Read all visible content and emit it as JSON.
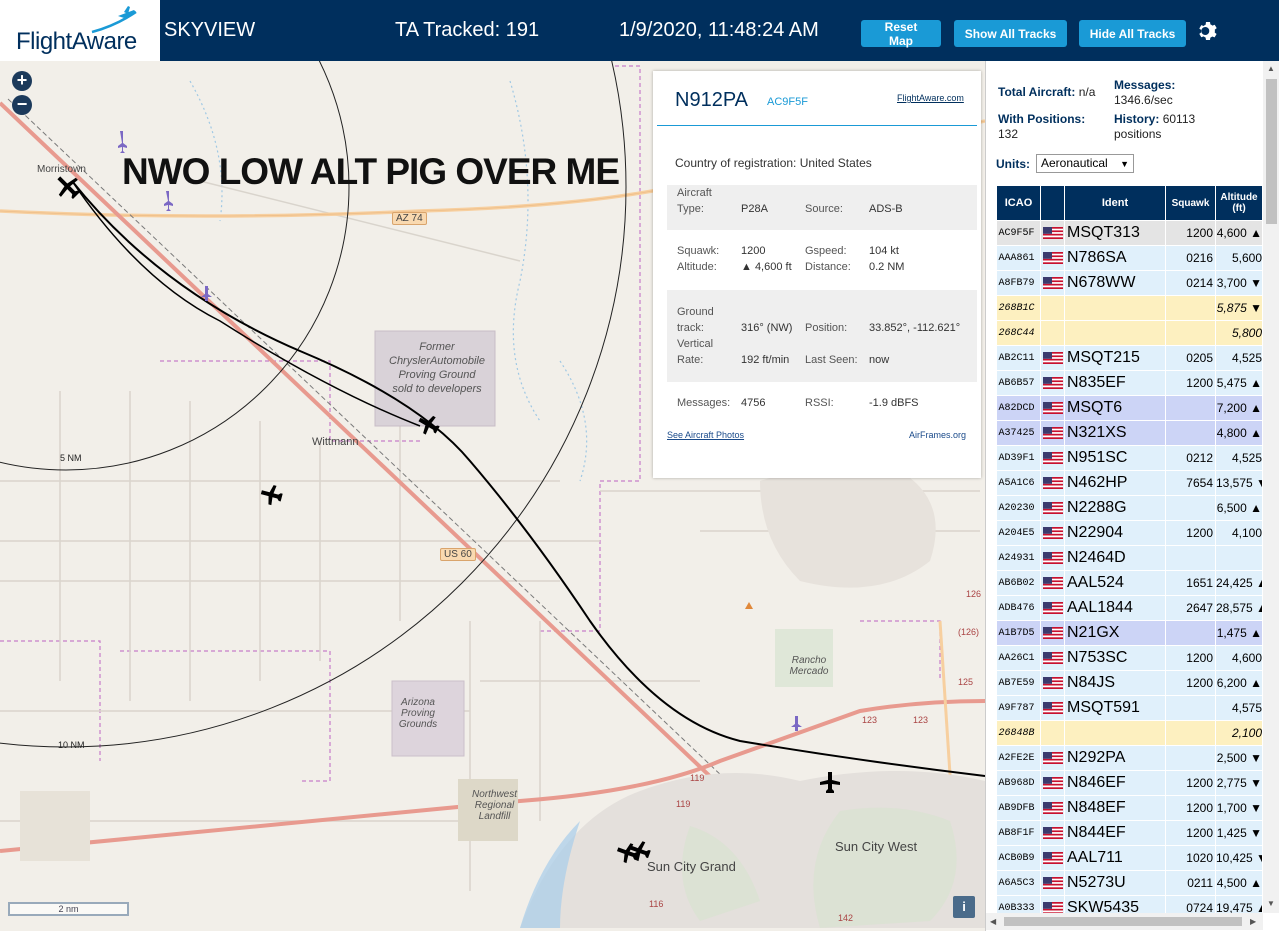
{
  "header": {
    "logo": "FlightAware",
    "title": "SKYVIEW",
    "tracked": "TA Tracked: 191",
    "datetime": "1/9/2020, 11:48:24 AM",
    "buttons": {
      "reset": "Reset Map",
      "show_all": "Show All Tracks",
      "hide_all": "Hide All Tracks"
    }
  },
  "map": {
    "overlay_text": "NWO LOW ALT PIG OVER ME",
    "zoom_in": "+",
    "zoom_out": "−",
    "labels": {
      "morristown": "Morristown",
      "wittmann": "Wittmann",
      "chrysler": "Former ChryslerAutomobile Proving Ground sold to developers",
      "arizona_pg": "Arizona Proving Grounds",
      "rancho": "Rancho Mercado",
      "landfill": "Northwest Regional Landfill",
      "sun_city_grand": "Sun City Grand",
      "sun_city_west": "Sun City West"
    },
    "shields": {
      "az74": "AZ 74",
      "us60": "US 60",
      "r123a": "123",
      "r123b": "123",
      "r119a": "119",
      "r119b": "119",
      "r116": "116",
      "r142": "142",
      "r126a": "126",
      "r126b": "(126)",
      "r125": "125"
    },
    "rings": {
      "r5": "5 NM",
      "r10": "10 NM"
    },
    "scale": "2 nm",
    "info": "i"
  },
  "popup": {
    "registration": "N912PA",
    "hex": "AC9F5F",
    "fa_link": "FlightAware.com",
    "country_label": "Country of registration:",
    "country": "United States",
    "aircraft_type_label": "Aircraft Type:",
    "aircraft_type_l1": "Aircraft",
    "aircraft_type_l2": "Type:",
    "aircraft_type": "P28A",
    "source_label": "Source:",
    "source": "ADS-B",
    "squawk_label": "Squawk:",
    "squawk": "1200",
    "gspeed_label": "Gspeed:",
    "gspeed": "104 kt",
    "altitude_label": "Altitude:",
    "altitude": "▲ 4,600 ft",
    "distance_label": "Distance:",
    "distance": "0.2 NM",
    "ground_track_l1": "Ground",
    "ground_track_l2": "track:",
    "ground_track": "316° (NW)",
    "position_label": "Position:",
    "position": "33.852°, -112.621°",
    "vertical_l1": "Vertical",
    "vertical_l2": "Rate:",
    "vertical_rate": "192 ft/min",
    "last_seen_label": "Last Seen:",
    "last_seen": "now",
    "messages_label": "Messages:",
    "messages": "4756",
    "rssi_label": "RSSI:",
    "rssi": "-1.9 dBFS",
    "photos_link": "See Aircraft Photos",
    "airframes_link": "AirFrames.org"
  },
  "stats": {
    "total_label": "Total Aircraft:",
    "total": "n/a",
    "messages_label": "Messages:",
    "messages": "1346.6/sec",
    "positions_label": "With Positions:",
    "positions": "132",
    "history_label": "History:",
    "history": "60113",
    "history_unit": "positions"
  },
  "units": {
    "label": "Units:",
    "selected": "Aeronautical"
  },
  "table": {
    "headers": {
      "icao": "ICAO",
      "ident": "Ident",
      "squawk": "Squawk",
      "altitude": "Altitude (ft)"
    },
    "rows": [
      {
        "icao": "AC9F5F",
        "flag": true,
        "ident": "MSQT313",
        "squawk": "1200",
        "altitude": "4,600 ▲",
        "style": "selected"
      },
      {
        "icao": "AAA861",
        "flag": true,
        "ident": "N786SA",
        "squawk": "0216",
        "altitude": "5,600",
        "style": "blue"
      },
      {
        "icao": "A8FB79",
        "flag": true,
        "ident": "N678WW",
        "squawk": "0214",
        "altitude": "3,700 ▼",
        "style": "blue"
      },
      {
        "icao": "268B1C",
        "flag": false,
        "ident": "",
        "squawk": "",
        "altitude": "5,875 ▼",
        "style": "yellow"
      },
      {
        "icao": "268C44",
        "flag": false,
        "ident": "",
        "squawk": "",
        "altitude": "5,800",
        "style": "yellow"
      },
      {
        "icao": "AB2C11",
        "flag": true,
        "ident": "MSQT215",
        "squawk": "0205",
        "altitude": "4,525",
        "style": "blue"
      },
      {
        "icao": "AB6B57",
        "flag": true,
        "ident": "N835EF",
        "squawk": "1200",
        "altitude": "5,475 ▲",
        "style": "blue"
      },
      {
        "icao": "A82DCD",
        "flag": true,
        "ident": "MSQT6",
        "squawk": "",
        "altitude": "7,200 ▲",
        "style": "purple"
      },
      {
        "icao": "A37425",
        "flag": true,
        "ident": "N321XS",
        "squawk": "",
        "altitude": "4,800 ▲",
        "style": "purple"
      },
      {
        "icao": "AD39F1",
        "flag": true,
        "ident": "N951SC",
        "squawk": "0212",
        "altitude": "4,525",
        "style": "blue"
      },
      {
        "icao": "A5A1C6",
        "flag": true,
        "ident": "N462HP",
        "squawk": "7654",
        "altitude": "13,575 ▼",
        "style": "blue"
      },
      {
        "icao": "A20230",
        "flag": true,
        "ident": "N2288G",
        "squawk": "",
        "altitude": "6,500 ▲",
        "style": "blue"
      },
      {
        "icao": "A204E5",
        "flag": true,
        "ident": "N22904",
        "squawk": "1200",
        "altitude": "4,100",
        "style": "blue"
      },
      {
        "icao": "A24931",
        "flag": true,
        "ident": "N2464D",
        "squawk": "",
        "altitude": "",
        "style": "blue"
      },
      {
        "icao": "AB6B02",
        "flag": true,
        "ident": "AAL524",
        "squawk": "1651",
        "altitude": "24,425 ▲",
        "style": "blue"
      },
      {
        "icao": "ADB476",
        "flag": true,
        "ident": "AAL1844",
        "squawk": "2647",
        "altitude": "28,575 ▲",
        "style": "blue"
      },
      {
        "icao": "A1B7D5",
        "flag": true,
        "ident": "N21GX",
        "squawk": "",
        "altitude": "1,475 ▲",
        "style": "purple"
      },
      {
        "icao": "AA26C1",
        "flag": true,
        "ident": "N753SC",
        "squawk": "1200",
        "altitude": "4,600",
        "style": "blue"
      },
      {
        "icao": "AB7E59",
        "flag": true,
        "ident": "N84JS",
        "squawk": "1200",
        "altitude": "6,200 ▲",
        "style": "blue"
      },
      {
        "icao": "A9F787",
        "flag": true,
        "ident": "MSQT591",
        "squawk": "",
        "altitude": "4,575",
        "style": "blue"
      },
      {
        "icao": "26848B",
        "flag": false,
        "ident": "",
        "squawk": "",
        "altitude": "2,100",
        "style": "yellow"
      },
      {
        "icao": "A2FE2E",
        "flag": true,
        "ident": "N292PA",
        "squawk": "",
        "altitude": "2,500 ▼",
        "style": "blue"
      },
      {
        "icao": "AB968D",
        "flag": true,
        "ident": "N846EF",
        "squawk": "1200",
        "altitude": "2,775 ▼",
        "style": "blue"
      },
      {
        "icao": "AB9DFB",
        "flag": true,
        "ident": "N848EF",
        "squawk": "1200",
        "altitude": "1,700 ▼",
        "style": "blue"
      },
      {
        "icao": "AB8F1F",
        "flag": true,
        "ident": "N844EF",
        "squawk": "1200",
        "altitude": "1,425 ▼",
        "style": "blue"
      },
      {
        "icao": "ACB0B9",
        "flag": true,
        "ident": "AAL711",
        "squawk": "1020",
        "altitude": "10,425 ▼",
        "style": "blue"
      },
      {
        "icao": "A6A5C3",
        "flag": true,
        "ident": "N5273U",
        "squawk": "0211",
        "altitude": "4,500 ▲",
        "style": "blue"
      },
      {
        "icao": "A0B333",
        "flag": true,
        "ident": "SKW5435",
        "squawk": "0724",
        "altitude": "19,475 ▲",
        "style": "blue"
      }
    ]
  },
  "colors": {
    "header_bg": "#002f5d",
    "button_bg": "#1a9ad6",
    "row_blue": "#e0f0fb",
    "row_yellow": "#fdf0c0",
    "row_purple": "#ccd4f6"
  }
}
